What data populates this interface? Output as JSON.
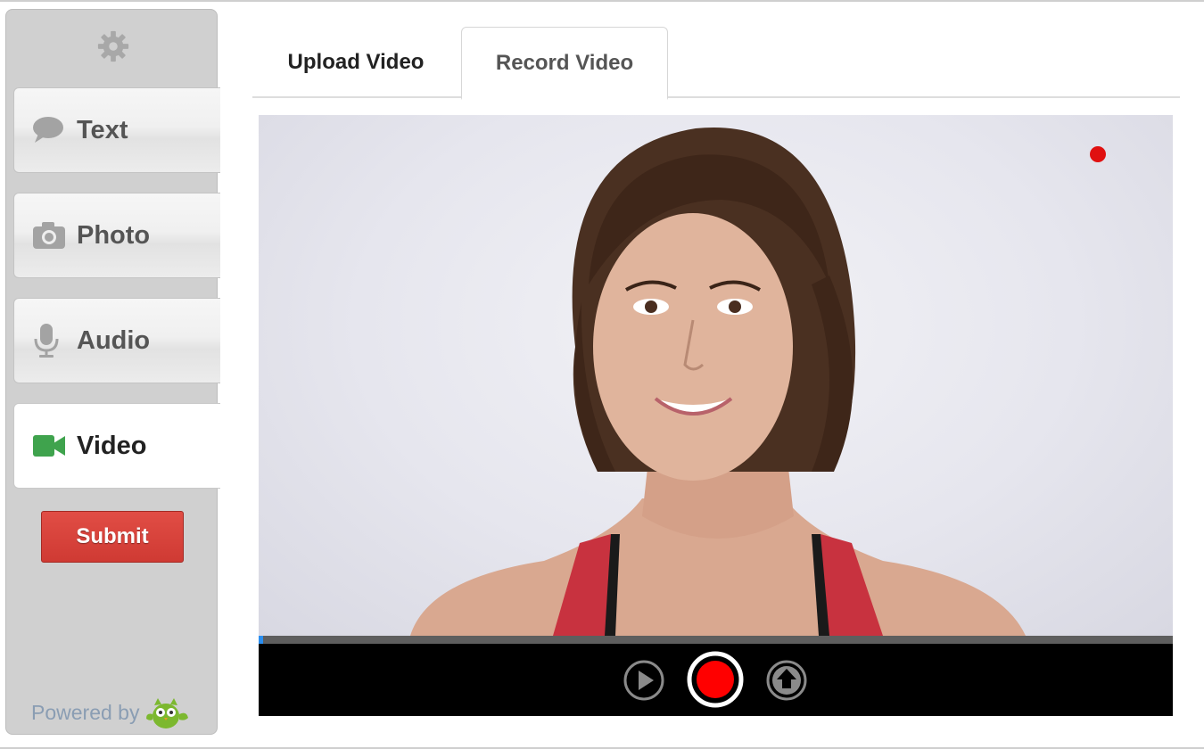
{
  "sidebar": {
    "items": [
      {
        "label": "Text",
        "icon": "speech-bubble-icon",
        "active": false
      },
      {
        "label": "Photo",
        "icon": "camera-icon",
        "active": false
      },
      {
        "label": "Audio",
        "icon": "microphone-icon",
        "active": false
      },
      {
        "label": "Video",
        "icon": "video-camera-icon",
        "active": true
      }
    ],
    "submit_label": "Submit",
    "powered_by": "Powered by",
    "settings_icon": "gear-icon",
    "logo_icon": "owl-logo-icon"
  },
  "tabs": [
    {
      "label": "Upload Video",
      "active": false
    },
    {
      "label": "Record Video",
      "active": true
    }
  ],
  "video": {
    "recording": true,
    "progress_percent": 0.5,
    "controls": [
      "play-icon",
      "record-icon",
      "upload-icon"
    ]
  },
  "colors": {
    "video_icon": "#3fa34d",
    "submit_bg": "#d9433c",
    "record_red": "#e01010",
    "progress_fill": "#2a8ef0",
    "logo_green": "#7cb82f"
  }
}
